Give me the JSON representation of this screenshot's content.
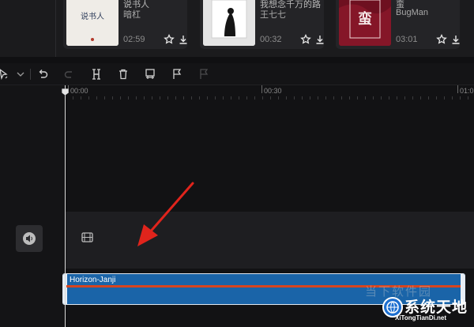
{
  "music": {
    "cards": [
      {
        "title": "说书人",
        "artist": "暗杠",
        "duration": "02:59",
        "cover_text": "说书人"
      },
      {
        "title": "我想念千万的路...",
        "artist": "王七七",
        "duration": "00:32"
      },
      {
        "title": "蛮",
        "artist": "BugMan",
        "duration": "03:01",
        "cover_text": "蛮"
      }
    ]
  },
  "toolbar": {
    "tools": [
      "select-cursor-icon",
      "undo-icon",
      "redo-icon",
      "split-icon",
      "delete-icon",
      "freeze-frame-icon",
      "marker-flag-icon",
      "marker-flag-disabled-icon"
    ]
  },
  "timeline": {
    "ruler_labels": [
      "00:00",
      "00:30",
      "01:0"
    ],
    "audio_clip_name": "Horizon-Janji"
  },
  "watermark": {
    "faint_text": "当下软件园",
    "brand": "系统天地",
    "url": "XiTongTianDi.net"
  },
  "colors": {
    "clip_blue": "#1a64a8",
    "waveform_orange": "#d7441e",
    "annotation_red": "#e0241c"
  }
}
